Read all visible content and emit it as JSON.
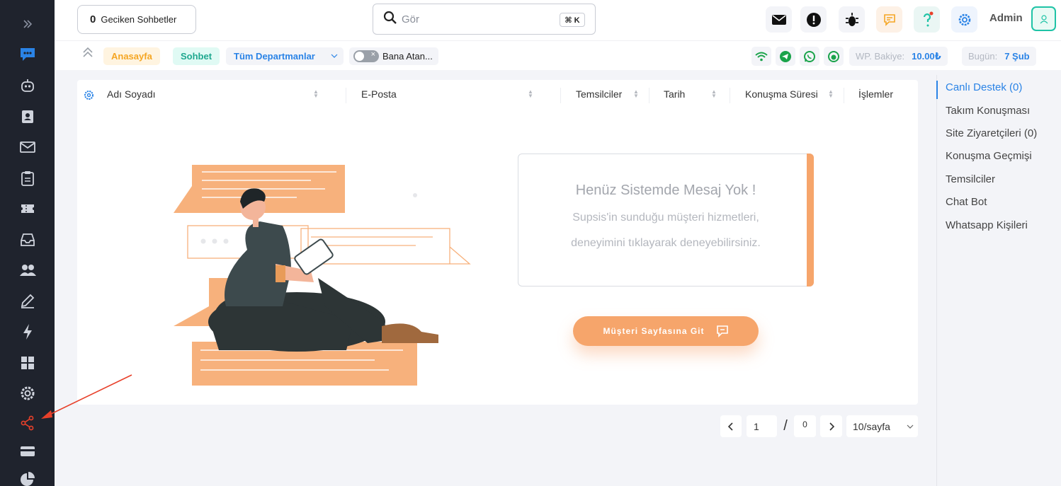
{
  "header": {
    "delayed_count": "0",
    "delayed_label": "Geciken Sohbetler",
    "search_placeholder": "Gör",
    "shortcut": "⌘ K",
    "admin_label": "Admin"
  },
  "subbar": {
    "home": "Anasayfa",
    "chat": "Sohbet",
    "departments": "Tüm Departmanlar",
    "assigned_toggle": "Bana Atan...",
    "wp_balance_label": "WP. Bakiye:",
    "wp_balance_value": "10.00₺",
    "today_label": "Bugün:",
    "today_value": "7 Şub"
  },
  "table": {
    "columns": [
      "Adı Soyadı",
      "E-Posta",
      "Temsilciler",
      "Tarih",
      "Konuşma Süresi",
      "İşlemler"
    ]
  },
  "empty": {
    "title": "Henüz Sistemde Mesaj Yok !",
    "line1": "Supsis'in sunduğu müşteri hizmetleri,",
    "line2": "deneyimini tıklayarak deneyebilirsiniz.",
    "cta": "Müşteri Sayfasına Git"
  },
  "pagination": {
    "current": "1",
    "separator": "/",
    "total": "0",
    "per_page": "10/sayfa"
  },
  "right_menu": {
    "items": [
      "Canlı Destek (0)",
      "Takım Konuşması",
      "Site Ziyaretçileri (0)",
      "Konuşma Geçmişi",
      "Temsilciler",
      "Chat Bot",
      "Whatsapp Kişileri"
    ]
  },
  "colors": {
    "accent_blue": "#2a83e6",
    "orange": "#f6a56b",
    "sidebar_bg": "#1f232d",
    "highlight_red": "#e8402a"
  },
  "sidebar_icons": [
    "expand-icon",
    "chat-icon",
    "robot-icon",
    "contacts-icon",
    "mail-icon",
    "clipboard-icon",
    "ticket-icon",
    "inbox-icon",
    "users-icon",
    "edit-icon",
    "lightning-icon",
    "grid-icon",
    "settings-icon",
    "share-icon",
    "card-icon",
    "pie-chart-icon"
  ]
}
